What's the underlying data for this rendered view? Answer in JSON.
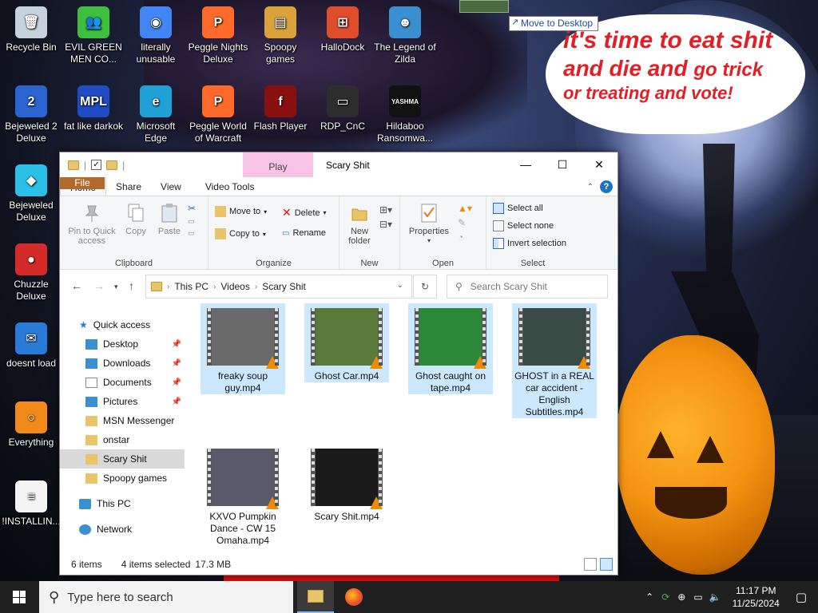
{
  "desktop": {
    "icons": [
      {
        "label": "Recycle Bin",
        "color": "#c7d2dc",
        "glyph": "🗑"
      },
      {
        "label": "EVIL GREEN MEN CO...",
        "color": "#3fbf3f",
        "glyph": "👥"
      },
      {
        "label": "literally unusable",
        "color": "#4285f4",
        "glyph": "◉"
      },
      {
        "label": "Peggle Nights Deluxe",
        "color": "#ff6a2a",
        "glyph": "P"
      },
      {
        "label": "Spoopy games",
        "color": "#d9a23a",
        "glyph": "▤"
      },
      {
        "label": "HalloDock",
        "color": "#e04d2a",
        "glyph": "⊞"
      },
      {
        "label": "The Legend of Zilda",
        "color": "#3a8fd0",
        "glyph": "☻"
      },
      {
        "label": "Bejeweled 2 Deluxe",
        "color": "#2a64d0",
        "glyph": "2"
      },
      {
        "label": "fat like darkok",
        "color": "#1f4bc4",
        "glyph": "MPL"
      },
      {
        "label": "Microsoft Edge",
        "color": "#1fa1d8",
        "glyph": "e"
      },
      {
        "label": "Peggle World of Warcraft",
        "color": "#ff6a2a",
        "glyph": "P"
      },
      {
        "label": "Flash Player",
        "color": "#8a1010",
        "glyph": "f"
      },
      {
        "label": "RDP_CnC",
        "color": "#2d2d2d",
        "glyph": "▭"
      },
      {
        "label": "Hildaboo Ransomwa...",
        "color": "#111111",
        "glyph": "YASHMA"
      },
      {
        "label": "Bejeweled Deluxe",
        "color": "#2ac0e8",
        "glyph": "◆"
      },
      {
        "label": "Chuzzle Deluxe",
        "color": "#d42a2a",
        "glyph": "●"
      },
      {
        "label": "doesnt load",
        "color": "#2a7ad8",
        "glyph": "✉"
      },
      {
        "label": "Everything",
        "color": "#f28a1a",
        "glyph": "○"
      },
      {
        "label": "!INSTALLIN...",
        "color": "#f4f4f4",
        "glyph": "≡"
      }
    ],
    "bubble": {
      "line1": "it's time to eat shit",
      "line2a": "and die and ",
      "line2b": "go trick",
      "line3": "or treating and vote!"
    },
    "drag_tooltip": "Move to Desktop"
  },
  "explorer": {
    "play_tab": "Play",
    "title": "Scary Shit",
    "window_buttons": {
      "minimize": "—",
      "maximize": "☐",
      "close": "✕"
    },
    "tabs": {
      "file": "File",
      "home": "Home",
      "share": "Share",
      "view": "View",
      "video_tools": "Video Tools"
    },
    "ribbon": {
      "clipboard": {
        "pin": "Pin to Quick access",
        "copy": "Copy",
        "paste": "Paste",
        "label": "Clipboard"
      },
      "organize": {
        "move_to": "Move to",
        "copy_to": "Copy to",
        "delete": "Delete",
        "rename": "Rename",
        "label": "Organize"
      },
      "new": {
        "new_folder": "New folder",
        "label": "New"
      },
      "open": {
        "properties": "Properties",
        "label": "Open"
      },
      "select": {
        "select_all": "Select all",
        "select_none": "Select none",
        "invert": "Invert selection",
        "label": "Select"
      }
    },
    "address": {
      "parts": [
        "This PC",
        "Videos",
        "Scary Shit"
      ],
      "search_placeholder": "Search Scary Shit"
    },
    "nav": {
      "quick_access": "Quick access",
      "items": [
        "Desktop",
        "Downloads",
        "Documents",
        "Pictures",
        "MSN Messenger",
        "onstar",
        "Scary Shit",
        "Spoopy games"
      ],
      "this_pc": "This PC",
      "network": "Network"
    },
    "files": [
      {
        "name": "freaky soup guy.mp4",
        "selected": true,
        "thumb": "#6a6a6a"
      },
      {
        "name": "Ghost Car.mp4",
        "selected": true,
        "thumb": "#5a7a3a"
      },
      {
        "name": "Ghost caught on tape.mp4",
        "selected": true,
        "thumb": "#2a8a3a"
      },
      {
        "name": "GHOST in a REAL car accident - English Subtitles.mp4",
        "selected": true,
        "thumb": "#3a4a44"
      },
      {
        "name": "KXVO Pumpkin Dance - CW 15 Omaha.mp4",
        "selected": false,
        "thumb": "#5a5a6a"
      },
      {
        "name": "Scary Shit.mp4",
        "selected": false,
        "thumb": "#1a1a1a"
      }
    ],
    "status": {
      "items": "6 items",
      "selected": "4 items selected",
      "size": "17.3 MB"
    }
  },
  "taskbar": {
    "search_placeholder": "Type here to search",
    "time": "11:17 PM",
    "date": "11/25/2024"
  }
}
